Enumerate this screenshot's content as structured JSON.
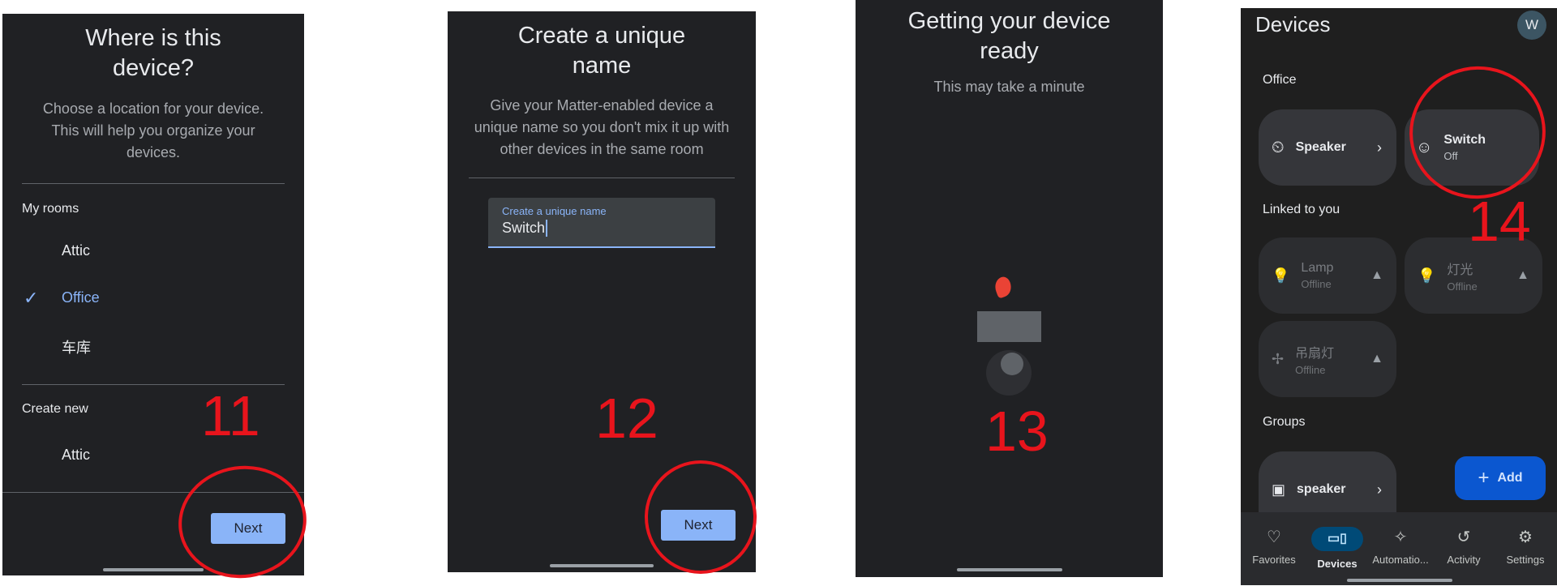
{
  "screen1": {
    "title": "Where is this device?",
    "subtitle": "Choose a location for your device. This will help you organize your devices.",
    "my_rooms_label": "My rooms",
    "rooms": [
      "Attic",
      "Office",
      "车库"
    ],
    "selected_room": "Office",
    "create_new_label": "Create new",
    "create_new_rooms": [
      "Attic"
    ],
    "next_label": "Next",
    "step": "11"
  },
  "screen2": {
    "title": "Create a unique name",
    "subtitle": "Give your Matter-enabled device a unique name so you don't mix it up with other devices in the same room",
    "input_label": "Create a unique name",
    "input_value": "Switch",
    "next_label": "Next",
    "step": "12"
  },
  "screen3": {
    "title": "Getting your device ready",
    "subtitle": "This may take a minute",
    "step": "13"
  },
  "screen4": {
    "title": "Devices",
    "avatar": "W",
    "office_label": "Office",
    "office_devices": [
      {
        "name": "Speaker",
        "icon": "speaker-icon"
      },
      {
        "name": "Switch",
        "status": "Off",
        "icon": "outlet-icon"
      }
    ],
    "linked_label": "Linked to you",
    "linked_devices": [
      {
        "name": "Lamp",
        "status": "Offline",
        "icon": "bulb-icon"
      },
      {
        "name": "灯光",
        "status": "Offline",
        "icon": "bulb-icon"
      },
      {
        "name": "吊扇灯",
        "status": "Offline",
        "icon": "fan-icon"
      }
    ],
    "groups_label": "Groups",
    "groups": [
      {
        "name": "speaker",
        "icon": "speaker-group-icon"
      }
    ],
    "add_label": "Add",
    "nav": [
      "Favorites",
      "Devices",
      "Automatio...",
      "Activity",
      "Settings"
    ],
    "active_nav": "Devices",
    "step": "14"
  },
  "colors": {
    "accent": "#8ab4f8",
    "annotation": "#e8141c",
    "background": "#202124"
  }
}
